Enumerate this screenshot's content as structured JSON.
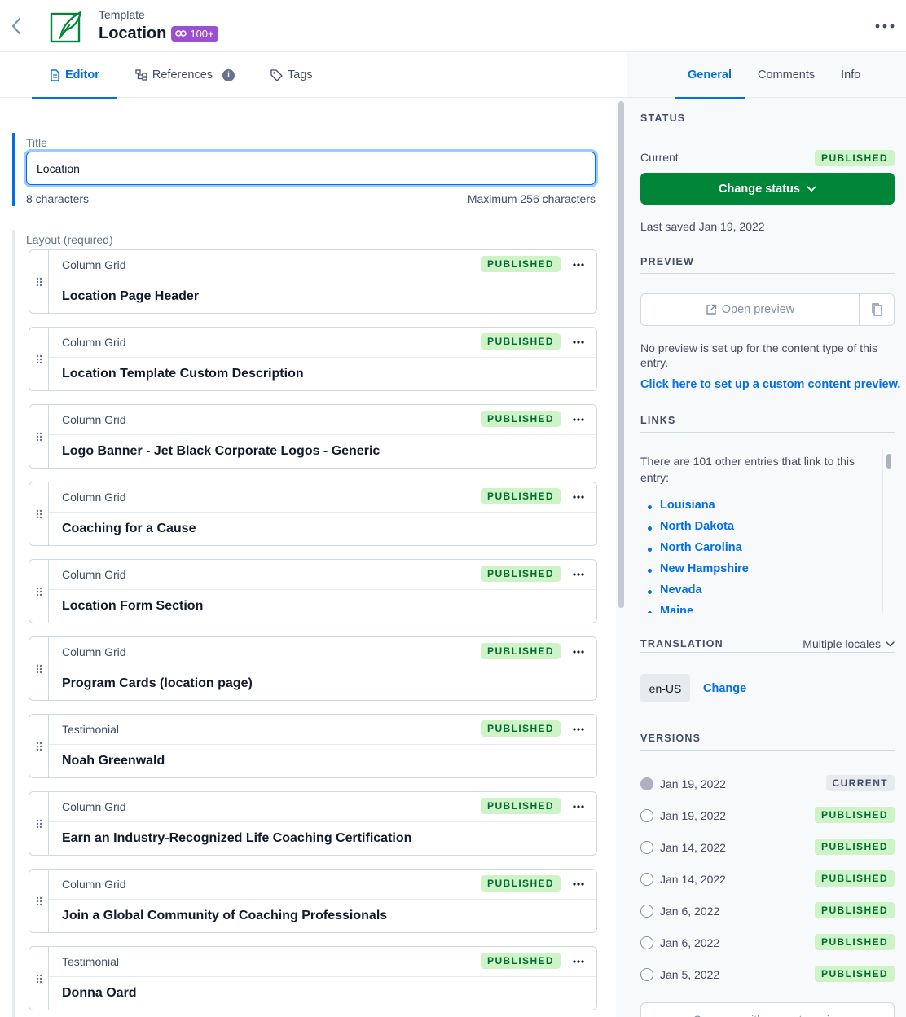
{
  "header": {
    "content_type": "Template",
    "entry_title": "Location",
    "link_count": "100+",
    "icons": {
      "back": "chevron-left-icon",
      "entry": "feather-icon",
      "more": "ellipsis-icon"
    }
  },
  "tabs": [
    {
      "label": "Editor",
      "icon": "document-icon",
      "active": true
    },
    {
      "label": "References",
      "icon": "hierarchy-icon",
      "active": false
    },
    {
      "label": "Tags",
      "icon": "tag-icon",
      "active": false
    }
  ],
  "title_field": {
    "label": "Title",
    "value": "Location",
    "char_count": "8 characters",
    "max_hint": "Maximum 256 characters"
  },
  "layout_field": {
    "label": "Layout (required)",
    "items": [
      {
        "type": "Column Grid",
        "title": "Location Page Header",
        "status": "PUBLISHED"
      },
      {
        "type": "Column Grid",
        "title": "Location Template Custom Description",
        "status": "PUBLISHED"
      },
      {
        "type": "Column Grid",
        "title": "Logo Banner - Jet Black Corporate Logos - Generic",
        "status": "PUBLISHED"
      },
      {
        "type": "Column Grid",
        "title": "Coaching for a Cause",
        "status": "PUBLISHED"
      },
      {
        "type": "Column Grid",
        "title": "Location Form Section",
        "status": "PUBLISHED"
      },
      {
        "type": "Column Grid",
        "title": "Program Cards (location page)",
        "status": "PUBLISHED"
      },
      {
        "type": "Testimonial",
        "title": "Noah Greenwald",
        "status": "PUBLISHED"
      },
      {
        "type": "Column Grid",
        "title": "Earn an Industry-Recognized Life Coaching Certification",
        "status": "PUBLISHED"
      },
      {
        "type": "Column Grid",
        "title": "Join a Global Community of Coaching Professionals",
        "status": "PUBLISHED"
      },
      {
        "type": "Testimonial",
        "title": "Donna Oard",
        "status": "PUBLISHED"
      }
    ]
  },
  "sidebar": {
    "tabs": [
      {
        "label": "General",
        "active": true
      },
      {
        "label": "Comments",
        "active": false
      },
      {
        "label": "Info",
        "active": false
      }
    ],
    "status": {
      "heading": "STATUS",
      "current_label": "Current",
      "badge": "PUBLISHED",
      "button": "Change status",
      "last_saved": "Last saved Jan 19, 2022"
    },
    "preview": {
      "heading": "PREVIEW",
      "button": "Open preview",
      "note": "No preview is set up for the content type of this entry.",
      "link": "Click here to set up a custom content preview."
    },
    "links": {
      "heading": "LINKS",
      "text": "There are 101 other entries that link to this entry:",
      "items": [
        "Louisiana",
        "North Dakota",
        "North Carolina",
        "New Hampshire",
        "Nevada",
        "Maine"
      ]
    },
    "translation": {
      "heading": "TRANSLATION",
      "select": "Multiple locales",
      "locale": "en-US",
      "change": "Change"
    },
    "versions": {
      "heading": "VERSIONS",
      "items": [
        {
          "date": "Jan 19, 2022",
          "badge": "CURRENT"
        },
        {
          "date": "Jan 19, 2022",
          "badge": "PUBLISHED"
        },
        {
          "date": "Jan 14, 2022",
          "badge": "PUBLISHED"
        },
        {
          "date": "Jan 14, 2022",
          "badge": "PUBLISHED"
        },
        {
          "date": "Jan 6, 2022",
          "badge": "PUBLISHED"
        },
        {
          "date": "Jan 6, 2022",
          "badge": "PUBLISHED"
        },
        {
          "date": "Jan 5, 2022",
          "badge": "PUBLISHED"
        }
      ],
      "compare": "Compare with current version"
    }
  },
  "colors": {
    "accent": "#036fe3",
    "published_bg": "#cdf3c6",
    "published_fg": "#006b32",
    "primary_button": "#008539",
    "link_badge": "#9c4fd1"
  }
}
